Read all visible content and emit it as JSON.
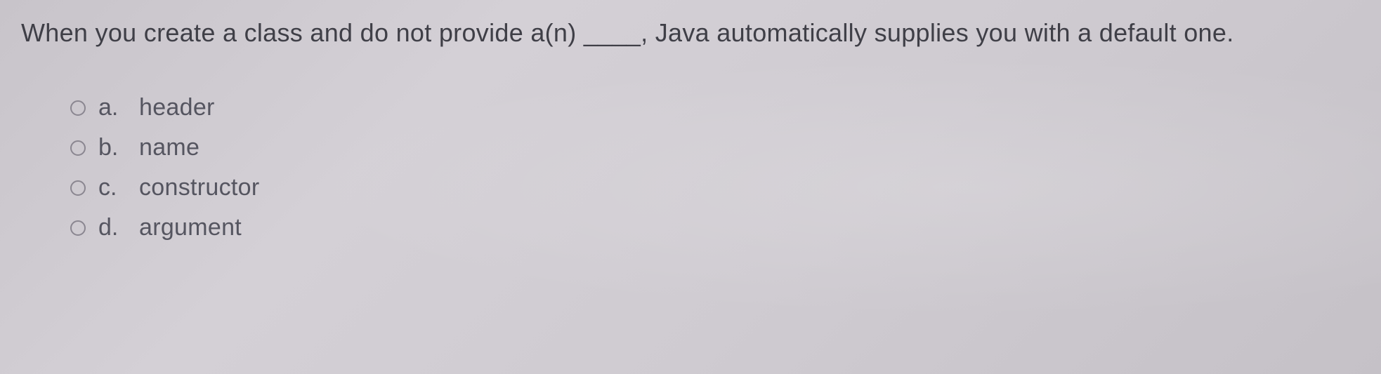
{
  "question": {
    "text": "When you create a class and do not provide a(n) ____, Java automatically supplies you with a default one."
  },
  "options": [
    {
      "letter": "a.",
      "text": "header"
    },
    {
      "letter": "b.",
      "text": "name"
    },
    {
      "letter": "c.",
      "text": "constructor"
    },
    {
      "letter": "d.",
      "text": "argument"
    }
  ]
}
